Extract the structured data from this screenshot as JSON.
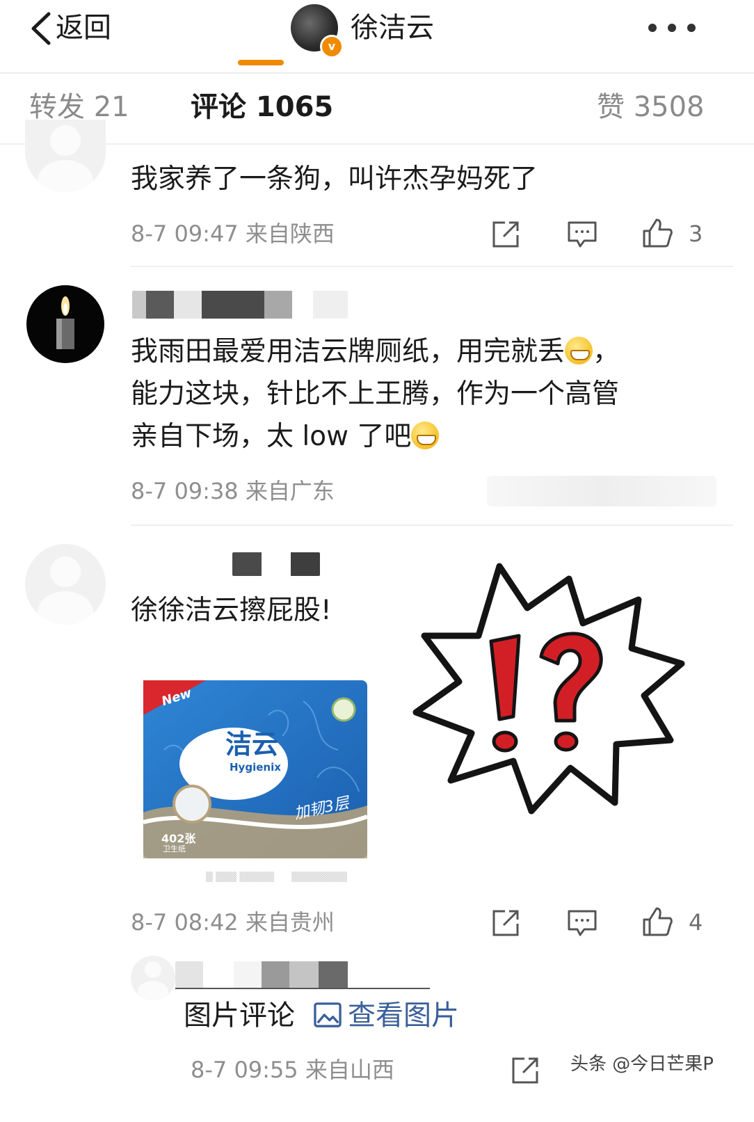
{
  "nav": {
    "back_label": "返回",
    "title": "徐洁云",
    "badge": "v",
    "back_icon": "chevron-left-icon",
    "more_icon": "more-dots-icon"
  },
  "tabs": {
    "repost": "转发 21",
    "comments": "评论 1065",
    "likes": "赞 3508",
    "accent": "#f08a00"
  },
  "comments": [
    {
      "text": "我家养了一条狗，叫许杰孕妈死了",
      "time": "8-7 09:47 来自陕西",
      "likes": "3"
    },
    {
      "lines": [
        "我雨田最爱用洁云牌厕纸，用完就丢",
        "，",
        "能力这块，针比不上王腾，作为一个高管",
        "亲自下场，太 low 了吧"
      ],
      "time": "8-7 09:38 来自广东"
    },
    {
      "text": "徐徐洁云擦屁股!",
      "time": "8-7 08:42 来自贵州",
      "likes": "4",
      "product": {
        "new_label": "New",
        "brand": "洁云",
        "brand_en": "Hygienix",
        "count": "402张",
        "sub": "卫生纸",
        "slogan": "加韧3层"
      }
    },
    {
      "links": {
        "picture_comment": "图片评论",
        "view_picture": "查看图片"
      },
      "time": "8-7 09:55 来自山西"
    }
  ],
  "footer": {
    "watermark": "头条 @今日芒果P"
  },
  "colors": {
    "orange": "#f08a00",
    "blue_link": "#3a5f9a",
    "meta_grey": "#8e8e8e"
  }
}
